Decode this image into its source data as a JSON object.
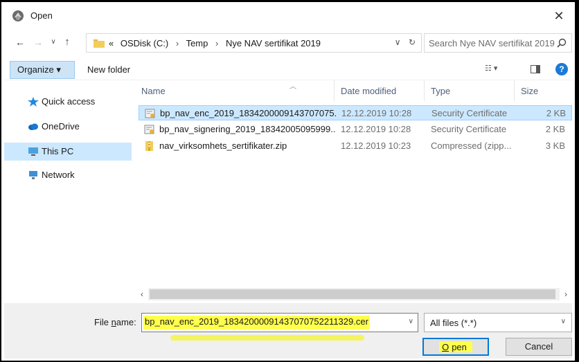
{
  "window": {
    "title": "Open"
  },
  "nav": {
    "breadcrumb": [
      "OSDisk (C:)",
      "Temp",
      "Nye NAV sertifikat 2019"
    ],
    "overflow": "«",
    "search_placeholder": "Search Nye NAV sertifikat 2019"
  },
  "toolbar": {
    "organize_label": "Organize ▾",
    "new_folder_label": "New folder"
  },
  "sidebar": {
    "items": [
      {
        "label": "Quick access",
        "icon": "star-icon"
      },
      {
        "label": "OneDrive",
        "icon": "cloud-icon"
      },
      {
        "label": "This PC",
        "icon": "computer-icon",
        "selected": true
      },
      {
        "label": "Network",
        "icon": "network-icon"
      }
    ]
  },
  "files": {
    "columns": {
      "name": "Name",
      "date": "Date modified",
      "type": "Type",
      "size": "Size"
    },
    "rows": [
      {
        "name": "bp_nav_enc_2019_1834200009143707075...",
        "date": "12.12.2019 10:28",
        "type": "Security Certificate",
        "size": "2 KB",
        "icon": "certificate-icon",
        "selected": true
      },
      {
        "name": "bp_nav_signering_2019_18342005095999...",
        "date": "12.12.2019 10:28",
        "type": "Security Certificate",
        "size": "2 KB",
        "icon": "certificate-icon",
        "selected": false
      },
      {
        "name": "nav_virksomhets_sertifikater.zip",
        "date": "12.12.2019 10:23",
        "type": "Compressed (zipp...",
        "size": "3 KB",
        "icon": "zip-folder-icon",
        "selected": false
      }
    ]
  },
  "bottom": {
    "file_name_label_prefix": "File ",
    "file_name_label_underlined": "n",
    "file_name_label_suffix": "ame:",
    "file_name_value": "bp_nav_enc_2019_18342000091437070752211329.cer",
    "file_type_value": "All files (*.*)",
    "open_label_underlined": "O",
    "open_label_rest": "pen",
    "cancel_label": "Cancel"
  },
  "colors": {
    "selection": "#cce8ff",
    "accent": "#0078d7",
    "highlight": "#ffff4d"
  }
}
